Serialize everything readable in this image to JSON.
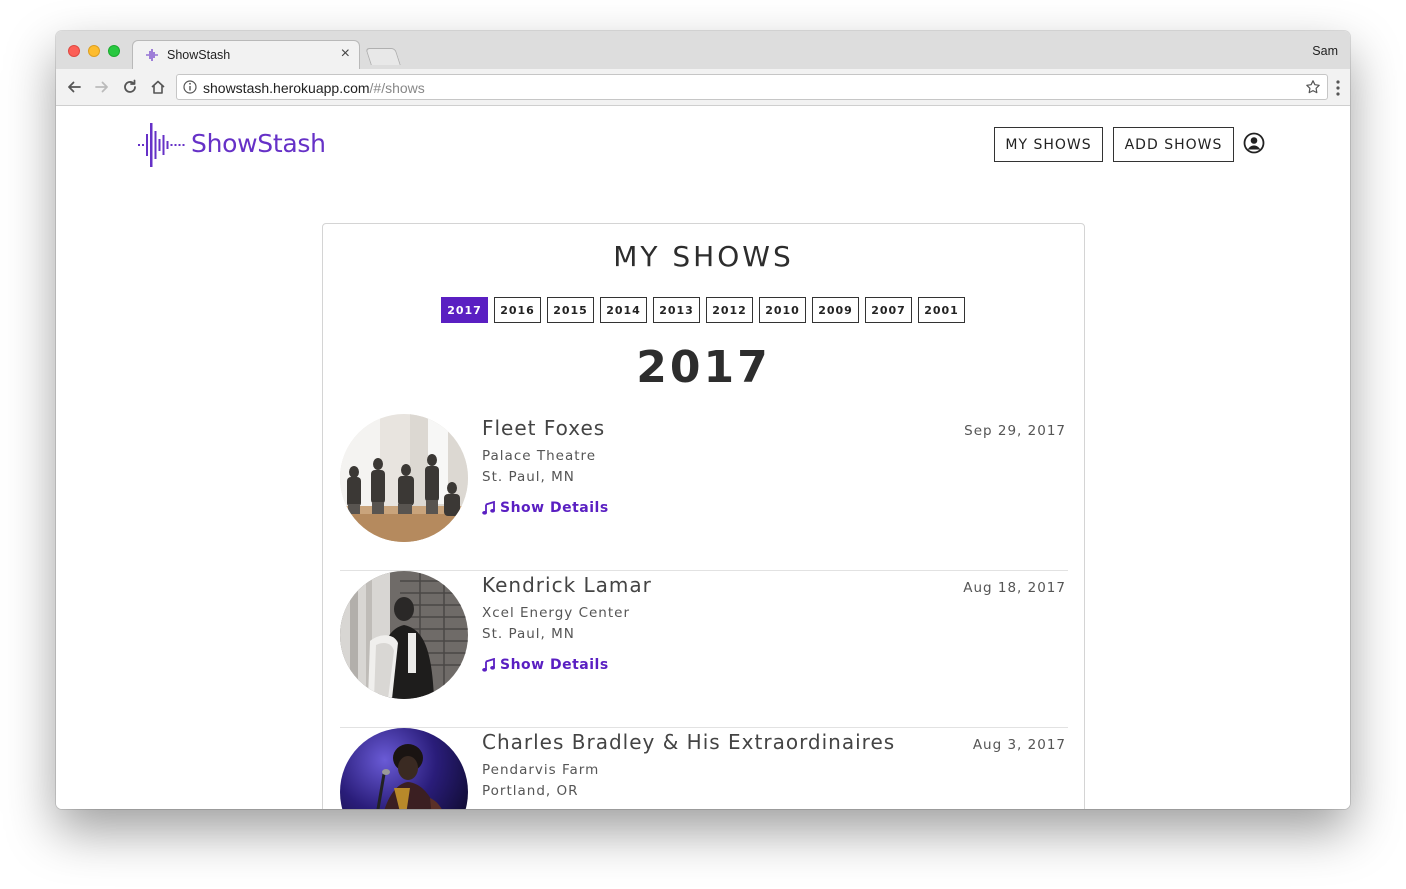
{
  "browser": {
    "tab_title": "ShowStash",
    "profile_name": "Sam",
    "url_host": "showstash.herokuapp.com",
    "url_path": "/#/shows"
  },
  "site": {
    "logo_text": "ShowStash",
    "nav": {
      "my_shows": "MY SHOWS",
      "add_shows": "ADD SHOWS"
    },
    "accent_color": "#5a1fc2"
  },
  "page": {
    "title": "MY SHOWS",
    "years": [
      "2017",
      "2016",
      "2015",
      "2014",
      "2013",
      "2012",
      "2010",
      "2009",
      "2007",
      "2001"
    ],
    "selected_year": "2017",
    "year_heading": "2017",
    "details_label": "Show Details",
    "shows": [
      {
        "artist": "Fleet Foxes",
        "venue": "Palace Theatre",
        "city": "St. Paul, MN",
        "date": "Sep 29, 2017"
      },
      {
        "artist": "Kendrick Lamar",
        "venue": "Xcel Energy Center",
        "city": "St. Paul, MN",
        "date": "Aug 18, 2017"
      },
      {
        "artist": "Charles Bradley & His Extraordinaires",
        "venue": "Pendarvis Farm",
        "city": "Portland, OR",
        "date": "Aug 3, 2017"
      }
    ]
  }
}
